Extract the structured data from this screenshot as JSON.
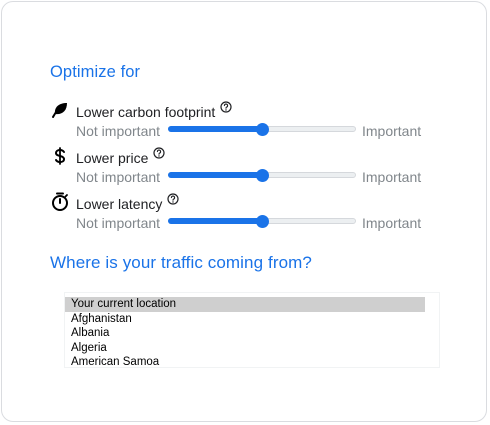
{
  "optimize": {
    "title": "Optimize for",
    "accent_color": "#1a73e8",
    "items": [
      {
        "label": "Lower carbon footprint",
        "icon": "leaf-icon",
        "min_label": "Not important",
        "max_label": "Important",
        "value": 0.5
      },
      {
        "label": "Lower price",
        "icon": "dollar-icon",
        "min_label": "Not important",
        "max_label": "Important",
        "value": 0.5
      },
      {
        "label": "Lower latency",
        "icon": "stopwatch-icon",
        "min_label": "Not important",
        "max_label": "Important",
        "value": 0.5
      }
    ]
  },
  "traffic": {
    "title": "Where is your traffic coming from?",
    "options": [
      "Your current location",
      "Afghanistan",
      "Albania",
      "Algeria",
      "American Samoa"
    ],
    "selected": "Your current location"
  }
}
